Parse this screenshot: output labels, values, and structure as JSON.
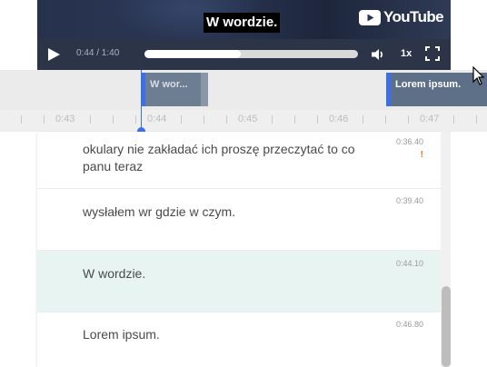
{
  "player": {
    "caption": "W wordzie.",
    "brand": "YouTube",
    "time_display": "0:44 / 1:40",
    "progress_fraction": 0.45,
    "speed": "1x"
  },
  "timeline": {
    "clips": [
      {
        "label": "W wor..."
      },
      {
        "label": "Lorem ipsum."
      }
    ],
    "ticks": [
      "0:43",
      "0:44",
      "0:45",
      "0:46",
      "0:47"
    ]
  },
  "transcript": [
    {
      "text": "okulary nie zakładać ich proszę przeczytać to co panu teraz",
      "time": "0:36.40",
      "warning": "!"
    },
    {
      "text": "wysłałem wr gdzie w czym.",
      "time": "0:39.40"
    },
    {
      "text": "W wordzie.",
      "time": "0:44.10"
    },
    {
      "text": "Lorem ipsum.",
      "time": "0:46.80"
    }
  ],
  "colors": {
    "accent": "#3b6ff0",
    "active_row": "#e7f4f1",
    "warning": "#e07a2e"
  }
}
